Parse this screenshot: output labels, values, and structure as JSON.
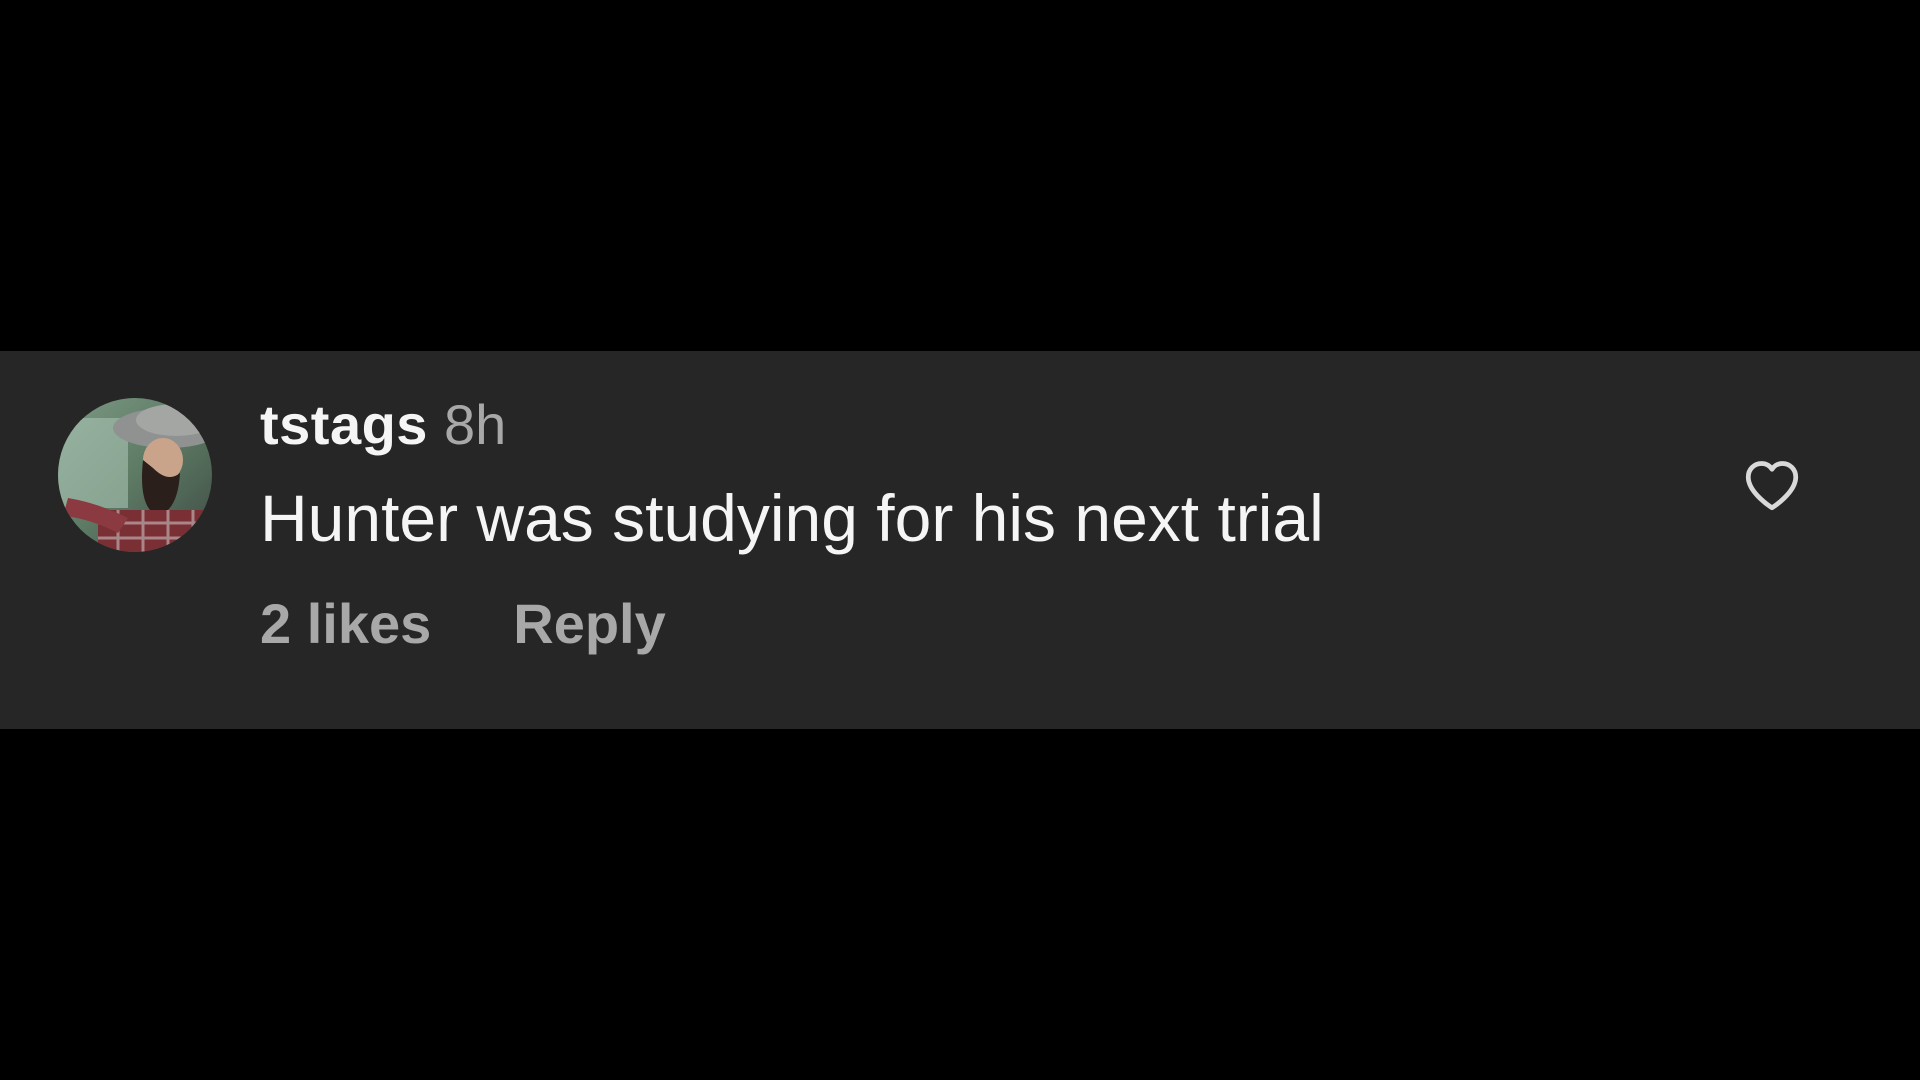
{
  "comment": {
    "username": "tstags",
    "timestamp": "8h",
    "text": "Hunter was studying for his next trial",
    "likes_label": "2 likes",
    "reply_label": "Reply",
    "avatar_icon": "user-avatar-photo",
    "like_icon": "heart-outline-icon"
  },
  "colors": {
    "page_background": "#000000",
    "comment_background": "#262626",
    "primary_text": "#f5f5f5",
    "secondary_text": "#a8a8a8"
  }
}
